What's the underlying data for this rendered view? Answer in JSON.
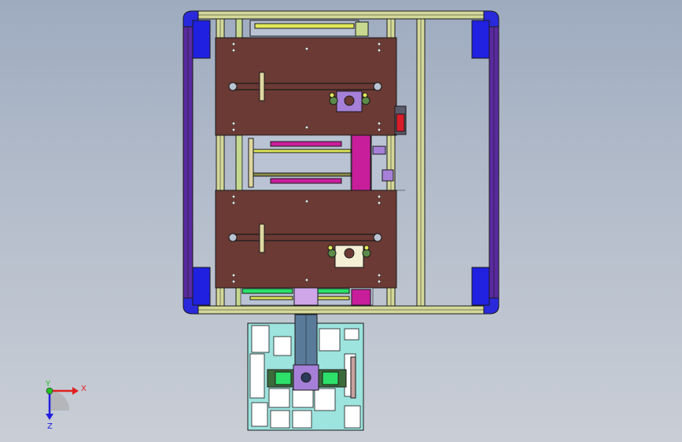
{
  "viewport": {
    "background_top": "#9eabbf",
    "background_bottom": "#c9ced6"
  },
  "model": {
    "frame_profile_color": "#d4d99a",
    "frame_edge_color": "#1a1a1a",
    "corner_bracket_color": "#2a2adc",
    "side_rail_color": "#5a2aa0",
    "plate_color": "#6b3a34",
    "linear_rail_color": "#e0e85a",
    "magenta_block_color": "#c81e9c",
    "motor_mount_color": "#a680d8",
    "base_plate_color": "#9de3de",
    "green_block_color": "#3c6b3a",
    "bright_green_color": "#2ce06a",
    "red_part_color": "#d81c2a",
    "upper_plate_count": 2,
    "belt_stations": 2
  },
  "triad": {
    "x_label": "X",
    "y_label": "Y",
    "z_label": "Z",
    "x_color": "#e02020",
    "y_color": "#20c020",
    "z_color": "#2020e0"
  }
}
